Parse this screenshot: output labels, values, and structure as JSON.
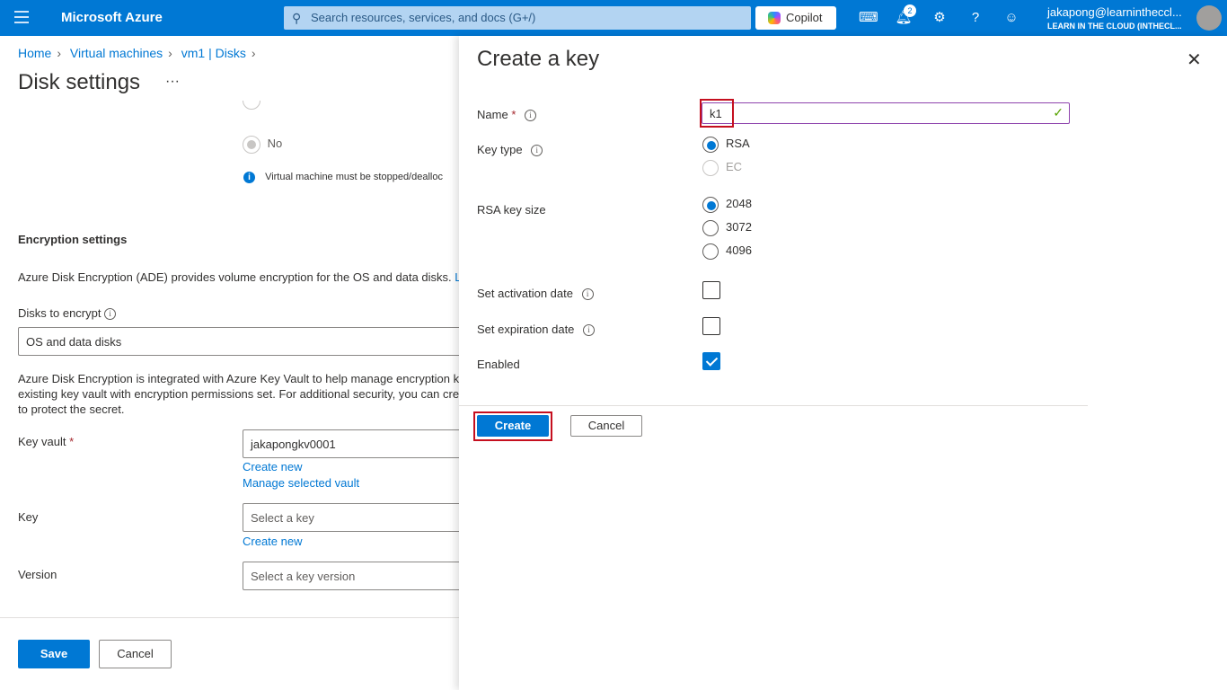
{
  "header": {
    "brand": "Microsoft Azure",
    "search_placeholder": "Search resources, services, and docs (G+/)",
    "copilot": "Copilot",
    "notifications_count": "2",
    "user_email": "jakapong@learnintheccl...",
    "user_tenant": "LEARN IN THE CLOUD (INTHECL...",
    "icons": [
      "menu-icon",
      "search-icon",
      "cloud-shell-icon",
      "bell-icon",
      "gear-icon",
      "help-icon",
      "feedback-icon"
    ]
  },
  "breadcrumb": [
    "Home",
    "Virtual machines",
    "vm1 | Disks"
  ],
  "page": {
    "title": "Disk settings",
    "more": "···"
  },
  "left": {
    "radio_no": "No",
    "vm_info": "Virtual machine must be stopped/dealloc",
    "encryption_heading": "Encryption settings",
    "ade_text": "Azure Disk Encryption (ADE) provides volume encryption for the OS and data disks.",
    "ade_link": "Le",
    "disks_label": "Disks to encrypt",
    "disks_value": "OS and data disks",
    "kv_text1": "Azure Disk Encryption is integrated with Azure Key Vault to help manage encryption k",
    "kv_text2": "existing key vault with encryption permissions set. For additional security, you can crea",
    "kv_text3": "to protect the secret.",
    "key_vault_label": "Key vault",
    "key_vault_value": "jakapongkv0001",
    "create_new": "Create new",
    "manage_vault": "Manage selected vault",
    "key_label": "Key",
    "key_placeholder": "Select a key",
    "key_create_new": "Create new",
    "version_label": "Version",
    "version_placeholder": "Select a key version",
    "save": "Save",
    "cancel": "Cancel"
  },
  "panel": {
    "title": "Create a key",
    "name_label": "Name",
    "name_value": "k1",
    "key_type_label": "Key type",
    "key_types": [
      {
        "label": "RSA",
        "selected": true
      },
      {
        "label": "EC",
        "selected": false,
        "disabled": true
      }
    ],
    "rsa_size_label": "RSA key size",
    "rsa_sizes": [
      {
        "label": "2048",
        "selected": true
      },
      {
        "label": "3072",
        "selected": false
      },
      {
        "label": "4096",
        "selected": false
      }
    ],
    "activation_label": "Set activation date",
    "activation_checked": false,
    "expiration_label": "Set expiration date",
    "expiration_checked": false,
    "enabled_label": "Enabled",
    "enabled_checked": true,
    "create": "Create",
    "cancel": "Cancel"
  },
  "colors": {
    "accent": "#0078d4",
    "highlight": "#c50f1f",
    "valid": "#57a300"
  }
}
